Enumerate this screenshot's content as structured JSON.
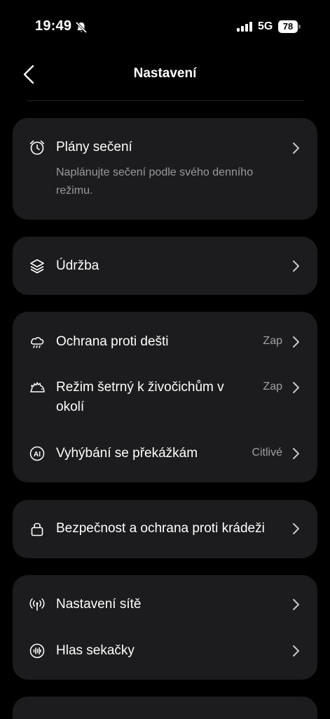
{
  "status_bar": {
    "time": "19:49",
    "network": "5G",
    "battery": "78",
    "icons": [
      "bell-muted-icon",
      "signal-icon",
      "battery-icon"
    ]
  },
  "header": {
    "title": "Nastavení",
    "back_icon": "chevron-left-icon"
  },
  "sections": [
    {
      "items": [
        {
          "label": "Plány sečení",
          "description": "Naplánujte sečení podle svého denního režimu.",
          "icon": "alarm-clock-icon"
        }
      ]
    },
    {
      "items": [
        {
          "label": "Údržba",
          "icon": "layers-icon"
        }
      ]
    },
    {
      "items": [
        {
          "label": "Ochrana proti dešti",
          "value": "Zap",
          "icon": "rain-cloud-icon"
        },
        {
          "label": "Režim šetrný k živočichům v okolí",
          "value": "Zap",
          "icon": "hedgehog-icon"
        },
        {
          "label": "Vyhýbání se překážkám",
          "value": "Citlivé",
          "icon": "ai-icon"
        }
      ]
    },
    {
      "items": [
        {
          "label": "Bezpečnost a ochrana proti krádeži",
          "icon": "lock-icon"
        }
      ]
    },
    {
      "items": [
        {
          "label": "Nastavení sítě",
          "icon": "antenna-icon"
        },
        {
          "label": "Hlas sekačky",
          "icon": "voice-icon"
        }
      ]
    }
  ],
  "colors": {
    "background": "#000000",
    "card": "#1c1c1e",
    "text": "#ffffff",
    "secondary_text": "#9a9a9e"
  }
}
